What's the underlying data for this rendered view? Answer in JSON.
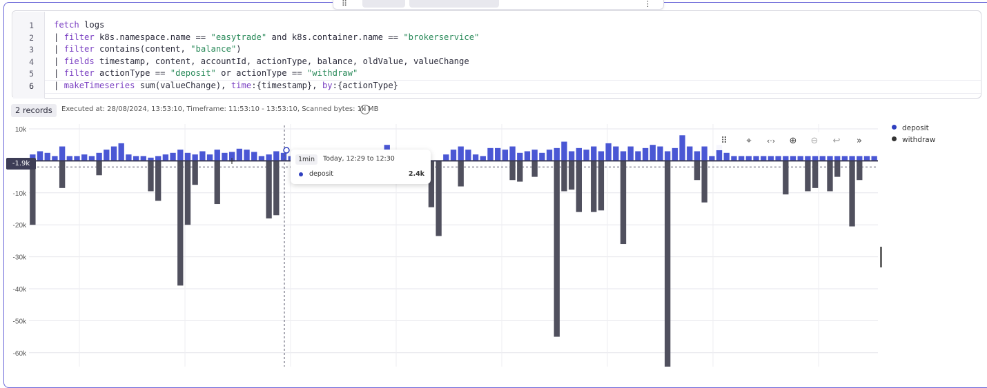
{
  "editor": {
    "line_numbers": [
      "1",
      "2",
      "3",
      "4",
      "5",
      "6"
    ]
  },
  "status": {
    "records": "2 records",
    "meta": "Executed at: 28/08/2024, 13:53:10, Timeframe: 11:53:10 - 13:53:10, Scanned bytes: 1k MB"
  },
  "legend": {
    "deposit": "deposit",
    "withdraw": "withdraw"
  },
  "crosshair_label": "-1.9k",
  "tooltip": {
    "granularity": "1min",
    "range": "Today, 12:29 to 12:30",
    "series": "deposit",
    "value": "2.4k"
  },
  "toolbar_icons": [
    "drag-handle-icon",
    "select-zoom-icon",
    "pan-icon",
    "zoom-in-icon",
    "zoom-out-icon",
    "reset-zoom-icon",
    "collapse-icon"
  ],
  "colors": {
    "deposit": "#4a57d4",
    "withdraw": "#50505e",
    "accent": "#6a66d8"
  },
  "chart_data": {
    "type": "bar",
    "y_ticks": [
      "10k",
      "0",
      "-10k",
      "-20k",
      "-30k",
      "-40k",
      "-50k",
      "-60k"
    ],
    "ylim": [
      -65000,
      10000
    ],
    "grid": true,
    "legend_position": "right",
    "series": [
      {
        "name": "deposit",
        "values": [
          2000,
          3000,
          2500,
          1500,
          4500,
          1500,
          1500,
          2000,
          1500,
          2500,
          3500,
          4500,
          5500,
          2000,
          1500,
          1500,
          1000,
          1500,
          2000,
          2500,
          3500,
          2500,
          2000,
          3000,
          2000,
          3500,
          2500,
          2800,
          3800,
          3500,
          2800,
          1500,
          2000,
          3000,
          2500,
          1500,
          2000,
          2400,
          null,
          3500,
          2500,
          1000,
          3000,
          1000,
          1000,
          3000,
          3000,
          3500,
          5000,
          1500,
          2000,
          1500,
          null,
          null,
          null,
          null,
          2000,
          3500,
          4500,
          3500,
          2000,
          1500,
          4000,
          4000,
          3500,
          4500,
          2500,
          3000,
          3500,
          2500,
          3500,
          4000,
          6000,
          3000,
          4000,
          3500,
          4500,
          3000,
          5500,
          4500,
          3000,
          4500,
          3000,
          4000,
          5000,
          4500,
          3000,
          4000,
          8000,
          4500,
          3000,
          4500,
          1500,
          5000,
          2500,
          1500,
          1500,
          1500,
          1500,
          1500,
          1500,
          1500,
          1500,
          1500,
          1500,
          1500,
          1500,
          1500,
          1500,
          1500,
          1500,
          1500,
          1500,
          1500,
          1500
        ]
      },
      {
        "name": "withdraw",
        "values": [
          -20000,
          null,
          null,
          null,
          -8500,
          null,
          null,
          null,
          null,
          -4500,
          null,
          null,
          null,
          null,
          null,
          null,
          -9500,
          -12500,
          null,
          null,
          -39000,
          -20000,
          -7500,
          null,
          null,
          -13500,
          null,
          null,
          null,
          null,
          null,
          null,
          -18000,
          -17000,
          null,
          null,
          null,
          null,
          null,
          null,
          null,
          null,
          null,
          null,
          null,
          null,
          null,
          null,
          null,
          null,
          null,
          null,
          null,
          null,
          -14500,
          -23500,
          null,
          null,
          -8000,
          null,
          null,
          null,
          null,
          null,
          null,
          -6000,
          -6500,
          null,
          -5000,
          null,
          null,
          -55000,
          -9500,
          -9000,
          -16000,
          null,
          -16000,
          -15500,
          null,
          null,
          -26000,
          null,
          null,
          null,
          null,
          null,
          -66000,
          null,
          null,
          null,
          -6000,
          -13000,
          null,
          null,
          null,
          null,
          null,
          null,
          null,
          null,
          null,
          null,
          -10500,
          null,
          null,
          -9500,
          -8500,
          null,
          -9500,
          -5000,
          null,
          -20500,
          -6000,
          null,
          null
        ]
      }
    ]
  }
}
